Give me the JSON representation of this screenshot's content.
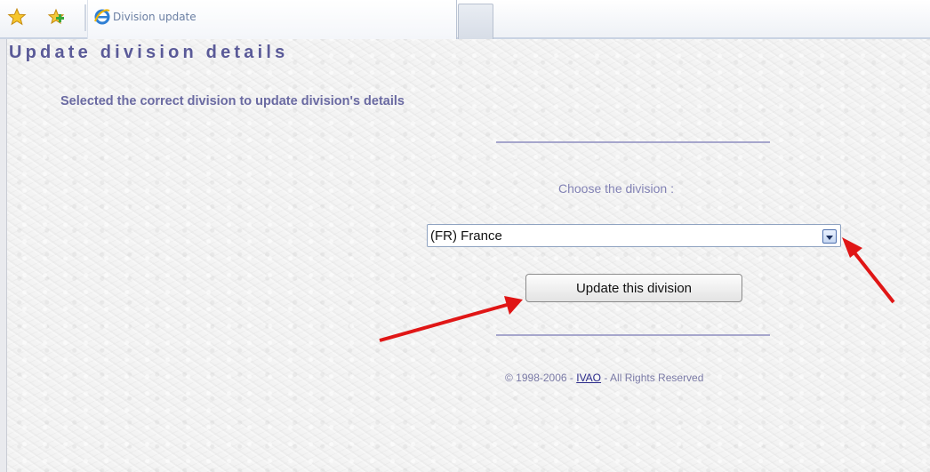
{
  "browser": {
    "tab_title": "Division update",
    "icons": [
      "favorites-star-icon",
      "add-favorite-icon",
      "ie-icon"
    ]
  },
  "page": {
    "title": "Update division details",
    "subtitle": "Selected the correct division to update division's details",
    "choose_label": "Choose the division :",
    "division_select": {
      "selected": "(FR) France"
    },
    "update_button_label": "Update this division",
    "footer": {
      "prefix": "© 1998-2006 - ",
      "link_text": "IVAO",
      "suffix": " - All Rights Reserved"
    }
  },
  "colors": {
    "title": "#5a5a98",
    "subtitle": "#6a6aa2",
    "divider": "#a6a6cc",
    "annotation_arrow": "#e01616"
  }
}
